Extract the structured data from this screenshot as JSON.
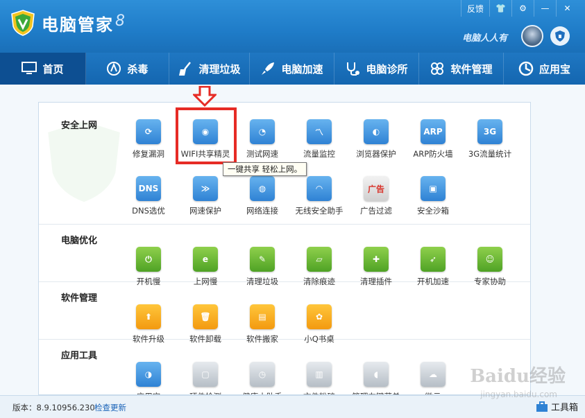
{
  "window": {
    "title": "电脑管家",
    "swoosh": "8",
    "controls": [
      "反馈",
      "👕",
      "⚙",
      "—",
      "✕"
    ],
    "user_name": "电脑人人有"
  },
  "nav": [
    {
      "label": "首页",
      "icon": "monitor-icon",
      "active": true
    },
    {
      "label": "杀毒",
      "icon": "virus-scan-icon"
    },
    {
      "label": "清理垃圾",
      "icon": "broom-icon"
    },
    {
      "label": "电脑加速",
      "icon": "rocket-icon"
    },
    {
      "label": "电脑诊所",
      "icon": "stethoscope-icon"
    },
    {
      "label": "软件管理",
      "icon": "software-icon"
    },
    {
      "label": "应用宝",
      "icon": "app-treasure-icon"
    }
  ],
  "sections": [
    {
      "title": "安全上网",
      "items": [
        [
          "修复漏洞",
          "repair-icon",
          "blue"
        ],
        [
          "WIFI共享精灵",
          "wifi-share-icon",
          "blue"
        ],
        [
          "测试网速",
          "speedometer-icon",
          "blue"
        ],
        [
          "流量监控",
          "traffic-chart-icon",
          "blue"
        ],
        [
          "浏览器保护",
          "browser-shield-icon",
          "blue"
        ],
        [
          "ARP防火墙",
          "arp-icon",
          "blue"
        ],
        [
          "3G流量统计",
          "3g-icon",
          "blue"
        ],
        [
          "DNS选优",
          "dns-icon",
          "blue"
        ],
        [
          "网速保护",
          "speed-shield-icon",
          "blue"
        ],
        [
          "网络连接",
          "globe-icon",
          "blue"
        ],
        [
          "无线安全助手",
          "wireless-icon",
          "blue"
        ],
        [
          "广告过滤",
          "ad-block-icon",
          "red"
        ],
        [
          "安全沙箱",
          "sandbox-icon",
          "blue"
        ]
      ]
    },
    {
      "title": "电脑优化",
      "items": [
        [
          "开机慢",
          "power-icon",
          "green"
        ],
        [
          "上网慢",
          "ie-icon",
          "green"
        ],
        [
          "清理垃圾",
          "broom-icon",
          "green"
        ],
        [
          "清除痕迹",
          "eraser-icon",
          "green"
        ],
        [
          "清理插件",
          "puzzle-icon",
          "green"
        ],
        [
          "开机加速",
          "rocket-icon",
          "green"
        ],
        [
          "专家协助",
          "expert-icon",
          "green"
        ]
      ]
    },
    {
      "title": "软件管理",
      "items": [
        [
          "软件升级",
          "upgrade-icon",
          "orange"
        ],
        [
          "软件卸载",
          "trash-icon",
          "orange"
        ],
        [
          "软件搬家",
          "truck-icon",
          "orange"
        ],
        [
          "小Q书桌",
          "clover-icon",
          "orange"
        ]
      ]
    },
    {
      "title": "应用工具",
      "items": [
        [
          "应用宝",
          "app-treasure-icon",
          "blue"
        ],
        [
          "硬件检测",
          "hardware-icon",
          "gray"
        ],
        [
          "健康小助手",
          "alarm-clock-icon",
          "gray"
        ],
        [
          "文件粉碎",
          "shredder-icon",
          "gray"
        ],
        [
          "管理右键菜单",
          "mouse-icon",
          "gray"
        ],
        [
          "微云",
          "cloud-icon",
          "gray"
        ]
      ]
    }
  ],
  "tile_glyphs": {
    "ARP防火墙": "ARP",
    "3G流量统计": "3G",
    "DNS选优": "DNS",
    "广告过滤": "广告"
  },
  "tooltip": "一键共享 轻松上网。",
  "status": {
    "version": "版本：8.9.10956.230",
    "update_link": "检查更新",
    "toolbox": "工具箱"
  },
  "watermark": {
    "main": "Baidu经验",
    "sub": "jingyan.baidu.com"
  },
  "colors": {
    "title_blue": "#1f7cc8",
    "nav_active": "#0d4f92",
    "highlight_red": "#e62b25",
    "link_blue": "#1a63b8"
  }
}
